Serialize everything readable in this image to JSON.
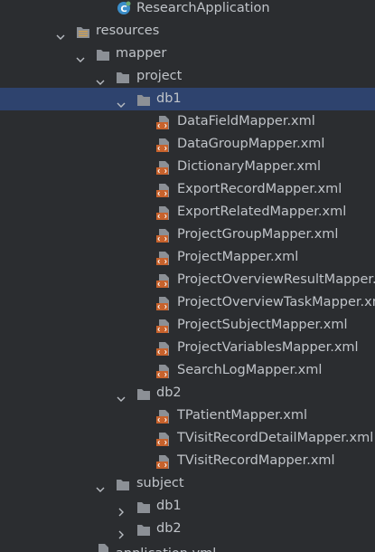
{
  "tree": {
    "app_class": {
      "label": "ResearchApplication",
      "icon": "spring-class-icon"
    },
    "resources": {
      "label": "resources",
      "icon": "resources-folder-icon",
      "mapper": {
        "label": "mapper",
        "project": {
          "label": "project",
          "db1": {
            "label": "db1",
            "files": [
              "DataFieldMapper.xml",
              "DataGroupMapper.xml",
              "DictionaryMapper.xml",
              "ExportRecordMapper.xml",
              "ExportRelatedMapper.xml",
              "ProjectGroupMapper.xml",
              "ProjectMapper.xml",
              "ProjectOverviewResultMapper.xml",
              "ProjectOverviewTaskMapper.xml",
              "ProjectSubjectMapper.xml",
              "ProjectVariablesMapper.xml",
              "SearchLogMapper.xml"
            ]
          },
          "db2": {
            "label": "db2",
            "files": [
              "TPatientMapper.xml",
              "TVisitRecordDetailMapper.xml",
              "TVisitRecordMapper.xml"
            ]
          }
        },
        "subject": {
          "label": "subject",
          "children": [
            "db1",
            "db2"
          ]
        }
      },
      "application_yml": "application.yml"
    },
    "colors": {
      "background": "#2b2d30",
      "selection": "#2e436e",
      "text": "#c0c4c9",
      "folder": "#8c9096",
      "xml_icon": "#c7622c"
    }
  }
}
